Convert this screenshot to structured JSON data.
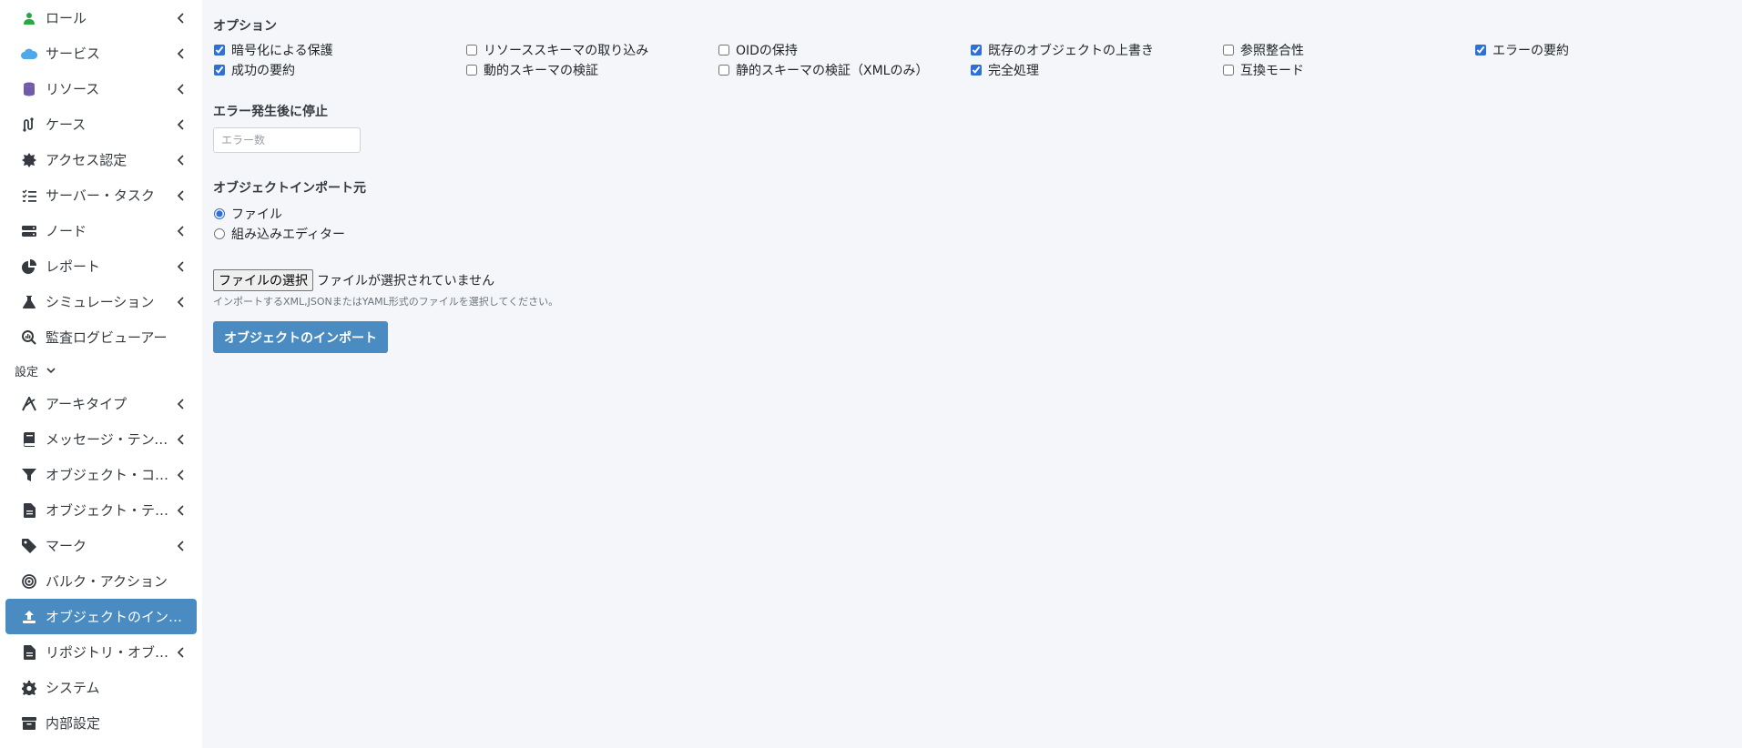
{
  "sidebar": {
    "items": [
      {
        "label": "ロール",
        "icon": "user-icon",
        "chevron": true
      },
      {
        "label": "サービス",
        "icon": "cloud-icon",
        "chevron": true
      },
      {
        "label": "リソース",
        "icon": "database-icon",
        "chevron": true
      },
      {
        "label": "ケース",
        "icon": "route-icon",
        "chevron": true
      },
      {
        "label": "アクセス認定",
        "icon": "certificate-icon",
        "chevron": true
      },
      {
        "label": "サーバー・タスク",
        "icon": "tasks-icon",
        "chevron": true
      },
      {
        "label": "ノード",
        "icon": "server-icon",
        "chevron": true
      },
      {
        "label": "レポート",
        "icon": "pie-chart-icon",
        "chevron": true
      },
      {
        "label": "シミュレーション",
        "icon": "flask-icon",
        "chevron": true
      },
      {
        "label": "監査ログビューアー",
        "icon": "search-chart-icon",
        "chevron": false
      }
    ],
    "settings_header": "設定",
    "settings_items": [
      {
        "label": "アーキタイプ",
        "icon": "archetype-icon",
        "chevron": true
      },
      {
        "label": "メッセージ・テンプ…",
        "icon": "book-icon",
        "chevron": true
      },
      {
        "label": "オブジェクト・コ…",
        "icon": "filter-icon",
        "chevron": true
      },
      {
        "label": "オブジェクト・テ…",
        "icon": "file-icon",
        "chevron": true
      },
      {
        "label": "マーク",
        "icon": "tag-icon",
        "chevron": true
      },
      {
        "label": "バルク・アクション",
        "icon": "bullseye-icon",
        "chevron": false
      },
      {
        "label": "オブジェクトのイン…",
        "icon": "upload-icon",
        "chevron": false,
        "active": true
      },
      {
        "label": "リポジトリ・オブ…",
        "icon": "file-icon",
        "chevron": true
      },
      {
        "label": "システム",
        "icon": "gear-icon",
        "chevron": false
      },
      {
        "label": "内部設定",
        "icon": "archive-icon",
        "chevron": false
      }
    ]
  },
  "main": {
    "options_title": "オプション",
    "options": [
      {
        "label": "暗号化による保護",
        "checked": true
      },
      {
        "label": "リソーススキーマの取り込み",
        "checked": false
      },
      {
        "label": "OIDの保持",
        "checked": false
      },
      {
        "label": "既存のオブジェクトの上書き",
        "checked": true
      },
      {
        "label": "参照整合性",
        "checked": false
      },
      {
        "label": "エラーの要約",
        "checked": true
      },
      {
        "label": "成功の要約",
        "checked": true
      },
      {
        "label": "動的スキーマの検証",
        "checked": false
      },
      {
        "label": "静的スキーマの検証（XMLのみ）",
        "checked": false
      },
      {
        "label": "完全処理",
        "checked": true
      },
      {
        "label": "互換モード",
        "checked": false
      }
    ],
    "stop_title": "エラー発生後に停止",
    "stop_placeholder": "エラー数",
    "source_title": "オブジェクトインポート元",
    "source_options": [
      {
        "label": "ファイル",
        "selected": true
      },
      {
        "label": "組み込みエディター",
        "selected": false
      }
    ],
    "file_button": "ファイルの選択",
    "file_status": "ファイルが選択されていません",
    "file_hint": "インポートするXML,JSONまたはYAML形式のファイルを選択してください。",
    "import_button": "オブジェクトのインポート"
  }
}
